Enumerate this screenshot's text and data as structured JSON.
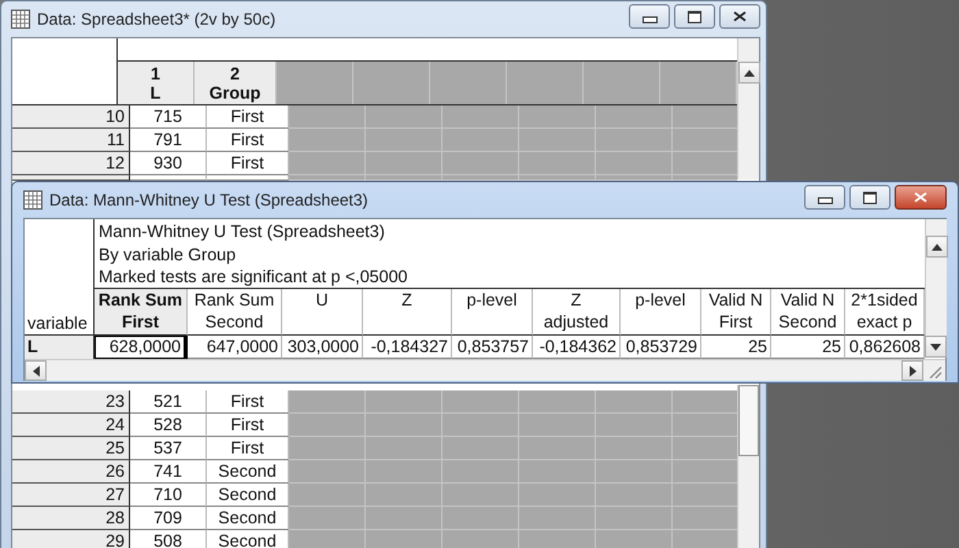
{
  "back_window": {
    "title": "Data: Spreadsheet3* (2v by 50c)",
    "active": false,
    "columns": [
      {
        "number": "1",
        "name": "L"
      },
      {
        "number": "2",
        "name": "Group"
      }
    ],
    "rows_top": [
      {
        "case": "10",
        "l": "715",
        "group": "First"
      },
      {
        "case": "11",
        "l": "791",
        "group": "First"
      },
      {
        "case": "12",
        "l": "930",
        "group": "First"
      }
    ],
    "rows_bottom": [
      {
        "case": "23",
        "l": "521",
        "group": "First"
      },
      {
        "case": "24",
        "l": "528",
        "group": "First"
      },
      {
        "case": "25",
        "l": "537",
        "group": "First"
      },
      {
        "case": "26",
        "l": "741",
        "group": "Second"
      },
      {
        "case": "27",
        "l": "710",
        "group": "Second"
      },
      {
        "case": "28",
        "l": "709",
        "group": "Second"
      },
      {
        "case": "29",
        "l": "508",
        "group": "Second"
      }
    ]
  },
  "front_window": {
    "title": "Data: Mann-Whitney U Test (Spreadsheet3)",
    "active": true,
    "header_lines": [
      "Mann-Whitney U Test (Spreadsheet3)",
      "By variable Group",
      "Marked tests are significant at p <,05000"
    ],
    "row_header_label": "variable",
    "columns": [
      {
        "lines": [
          "Rank Sum",
          "First"
        ],
        "bold": true
      },
      {
        "lines": [
          "Rank Sum",
          "Second"
        ],
        "bold": false
      },
      {
        "lines": [
          "U"
        ],
        "bold": false
      },
      {
        "lines": [
          "Z"
        ],
        "bold": false
      },
      {
        "lines": [
          "p-level"
        ],
        "bold": false
      },
      {
        "lines": [
          "Z",
          "adjusted"
        ],
        "bold": false
      },
      {
        "lines": [
          "p-level"
        ],
        "bold": false
      },
      {
        "lines": [
          "Valid N",
          "First"
        ],
        "bold": false
      },
      {
        "lines": [
          "Valid N",
          "Second"
        ],
        "bold": false
      },
      {
        "lines": [
          "2*1sided",
          "exact p"
        ],
        "bold": false
      }
    ],
    "rows": [
      {
        "variable": "L",
        "cells": [
          {
            "value": "628,0000",
            "selected": true
          },
          {
            "value": "647,0000",
            "selected": false
          },
          {
            "value": "303,0000",
            "selected": false
          },
          {
            "value": "-0,184327",
            "selected": false
          },
          {
            "value": "0,853757",
            "selected": false
          },
          {
            "value": "-0,184362",
            "selected": false
          },
          {
            "value": "0,853729",
            "selected": false
          },
          {
            "value": "25",
            "selected": false
          },
          {
            "value": "25",
            "selected": false
          },
          {
            "value": "0,862608",
            "selected": false
          }
        ]
      }
    ]
  }
}
